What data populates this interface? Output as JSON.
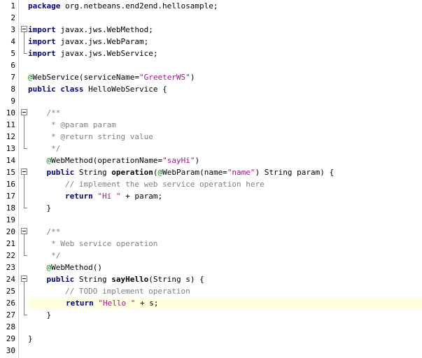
{
  "editor": {
    "lines": [
      {
        "num": "1",
        "tokens": [
          {
            "t": "package",
            "k": "keyword"
          },
          {
            "t": " org.netbeans.end2end.hellosample;",
            "k": "text"
          }
        ]
      },
      {
        "num": "2",
        "tokens": []
      },
      {
        "num": "3",
        "tokens": [
          {
            "t": "import",
            "k": "keyword"
          },
          {
            "t": " javax.jws.WebMethod;",
            "k": "text"
          }
        ]
      },
      {
        "num": "4",
        "tokens": [
          {
            "t": "import",
            "k": "keyword"
          },
          {
            "t": " javax.jws.WebParam;",
            "k": "text"
          }
        ]
      },
      {
        "num": "5",
        "tokens": [
          {
            "t": "import",
            "k": "keyword"
          },
          {
            "t": " javax.jws.WebService;",
            "k": "text"
          }
        ]
      },
      {
        "num": "6",
        "tokens": []
      },
      {
        "num": "7",
        "tokens": [
          {
            "t": "@",
            "k": "annotation"
          },
          {
            "t": "WebService(serviceName=",
            "k": "text"
          },
          {
            "t": "\"GreeterWS\"",
            "k": "string"
          },
          {
            "t": ")",
            "k": "text"
          }
        ]
      },
      {
        "num": "8",
        "tokens": [
          {
            "t": "public",
            "k": "keyword"
          },
          {
            "t": " ",
            "k": "text"
          },
          {
            "t": "class",
            "k": "keyword"
          },
          {
            "t": " HelloWebService {",
            "k": "text"
          }
        ]
      },
      {
        "num": "9",
        "tokens": []
      },
      {
        "num": "10",
        "tokens": [
          {
            "t": "    /**",
            "k": "comment"
          }
        ]
      },
      {
        "num": "11",
        "tokens": [
          {
            "t": "     * @param param",
            "k": "comment"
          }
        ]
      },
      {
        "num": "12",
        "tokens": [
          {
            "t": "     * @return string value",
            "k": "comment"
          }
        ]
      },
      {
        "num": "13",
        "tokens": [
          {
            "t": "     */",
            "k": "comment"
          }
        ]
      },
      {
        "num": "14",
        "tokens": [
          {
            "t": "    ",
            "k": "text"
          },
          {
            "t": "@",
            "k": "annotation"
          },
          {
            "t": "WebMethod(operationName=",
            "k": "text"
          },
          {
            "t": "\"sayHi\"",
            "k": "string"
          },
          {
            "t": ")",
            "k": "text"
          }
        ]
      },
      {
        "num": "15",
        "tokens": [
          {
            "t": "    ",
            "k": "text"
          },
          {
            "t": "public",
            "k": "keyword"
          },
          {
            "t": " String ",
            "k": "text"
          },
          {
            "t": "operation",
            "k": "method"
          },
          {
            "t": "(",
            "k": "text"
          },
          {
            "t": "@",
            "k": "annotation"
          },
          {
            "t": "WebParam(name=",
            "k": "text"
          },
          {
            "t": "\"name\"",
            "k": "string"
          },
          {
            "t": ") String param) {",
            "k": "text"
          }
        ]
      },
      {
        "num": "16",
        "tokens": [
          {
            "t": "        // implement the web service operation here",
            "k": "comment"
          }
        ]
      },
      {
        "num": "17",
        "tokens": [
          {
            "t": "        ",
            "k": "text"
          },
          {
            "t": "return",
            "k": "keyword"
          },
          {
            "t": " ",
            "k": "text"
          },
          {
            "t": "\"Hi \"",
            "k": "string"
          },
          {
            "t": " + param;",
            "k": "text"
          }
        ]
      },
      {
        "num": "18",
        "tokens": [
          {
            "t": "    }",
            "k": "text"
          }
        ]
      },
      {
        "num": "19",
        "tokens": []
      },
      {
        "num": "20",
        "tokens": [
          {
            "t": "    /**",
            "k": "comment"
          }
        ]
      },
      {
        "num": "21",
        "tokens": [
          {
            "t": "     * Web service operation",
            "k": "comment"
          }
        ]
      },
      {
        "num": "22",
        "tokens": [
          {
            "t": "     */",
            "k": "comment"
          }
        ]
      },
      {
        "num": "23",
        "tokens": [
          {
            "t": "    ",
            "k": "text"
          },
          {
            "t": "@",
            "k": "annotation"
          },
          {
            "t": "WebMethod()",
            "k": "text"
          }
        ]
      },
      {
        "num": "24",
        "tokens": [
          {
            "t": "    ",
            "k": "text"
          },
          {
            "t": "public",
            "k": "keyword"
          },
          {
            "t": " String ",
            "k": "text"
          },
          {
            "t": "sayHello",
            "k": "method"
          },
          {
            "t": "(String s) {",
            "k": "text"
          }
        ]
      },
      {
        "num": "25",
        "tokens": [
          {
            "t": "        // TODO implement operation",
            "k": "comment"
          }
        ]
      },
      {
        "num": "26",
        "tokens": [
          {
            "t": "        ",
            "k": "text"
          },
          {
            "t": "return",
            "k": "keyword"
          },
          {
            "t": " ",
            "k": "text"
          },
          {
            "t": "\"Hello \"",
            "k": "string"
          },
          {
            "t": " + s;",
            "k": "text"
          }
        ]
      },
      {
        "num": "27",
        "tokens": [
          {
            "t": "    }",
            "k": "text"
          }
        ]
      },
      {
        "num": "28",
        "tokens": []
      },
      {
        "num": "29",
        "tokens": [
          {
            "t": "}",
            "k": "text"
          }
        ]
      },
      {
        "num": "30",
        "tokens": []
      }
    ],
    "current_line": "26",
    "colors": {
      "keyword": "#000080",
      "string": "#a1158b",
      "comment": "#808080",
      "annotation": "#008000",
      "current_line_bg": "#ffffe0"
    }
  }
}
